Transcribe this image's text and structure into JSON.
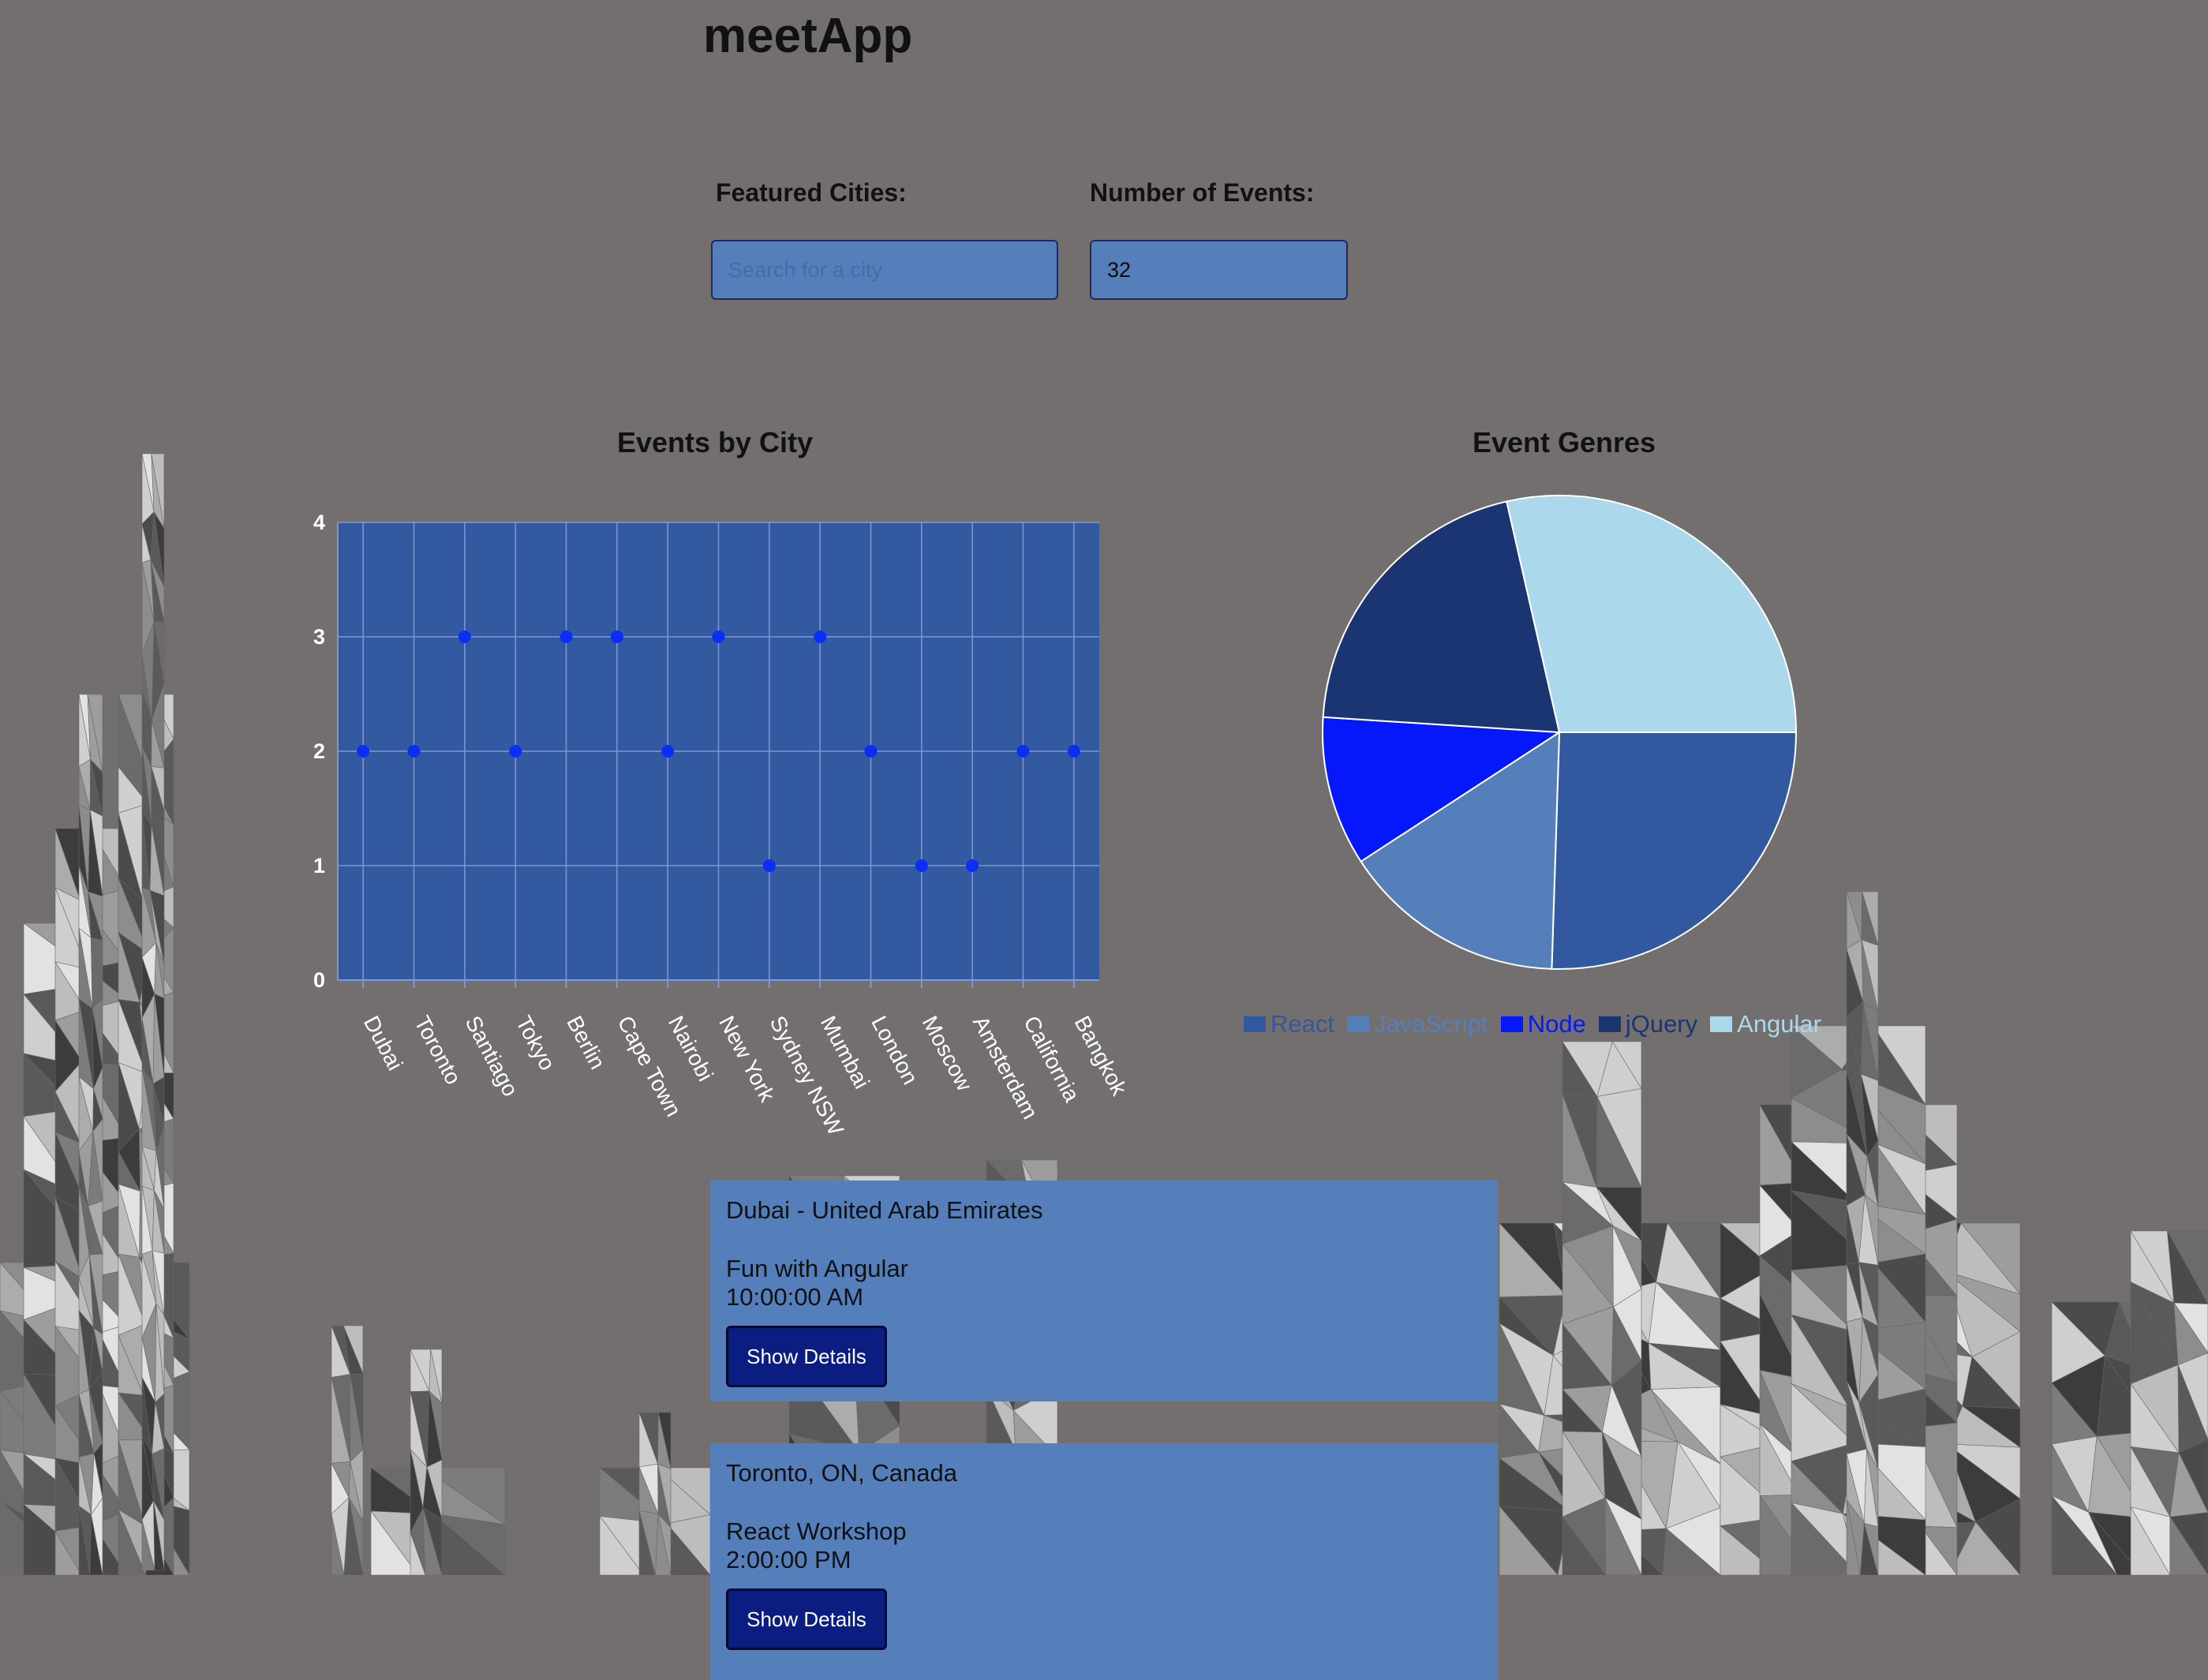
{
  "app": {
    "title": "meetApp"
  },
  "search": {
    "label": "Featured Cities:",
    "placeholder": "Search for a city",
    "value": ""
  },
  "events_count": {
    "label": "Number of Events:",
    "value": "32"
  },
  "charts": {
    "scatter_title": "Events by City",
    "pie_title": "Event Genres"
  },
  "chart_data": [
    {
      "type": "scatter",
      "title": "Events by City",
      "categories": [
        "Dubai",
        "Toronto",
        "Santiago",
        "Tokyo",
        "Berlin",
        "Cape Town",
        "Nairobi",
        "New York",
        "Sydney NSW",
        "Mumbai",
        "London",
        "Moscow",
        "Amsterdam",
        "California",
        "Bangkok"
      ],
      "values": [
        2,
        2,
        3,
        2,
        3,
        3,
        2,
        3,
        1,
        3,
        2,
        1,
        1,
        2,
        2
      ],
      "ylim": [
        0,
        4
      ],
      "yticks": [
        0,
        1,
        2,
        3,
        4
      ],
      "grid": true,
      "colors": {
        "plot_bg": "#3359a0",
        "grid": "#7c99d4",
        "point": "#0a2ef5",
        "tick_label": "#ffffff"
      }
    },
    {
      "type": "pie",
      "title": "Event Genres",
      "legend_placement": "bottom",
      "slices": [
        {
          "label": "React",
          "value": 25,
          "color": "#3259a0"
        },
        {
          "label": "JavaScript",
          "value": 15,
          "color": "#557fbb"
        },
        {
          "label": "Node",
          "value": 10,
          "color": "#0518fb"
        },
        {
          "label": "jQuery",
          "value": 20,
          "color": "#1b3572"
        },
        {
          "label": "Angular",
          "value": 28,
          "color": "#acd8eb"
        }
      ]
    }
  ],
  "events": [
    {
      "location": "Dubai - United Arab Emirates",
      "summary": "Fun with Angular",
      "time": "10:00:00 AM",
      "button_label": "Show Details"
    },
    {
      "location": "Toronto, ON, Canada",
      "summary": "React Workshop",
      "time": "2:00:00 PM",
      "button_label": "Show Details"
    }
  ]
}
